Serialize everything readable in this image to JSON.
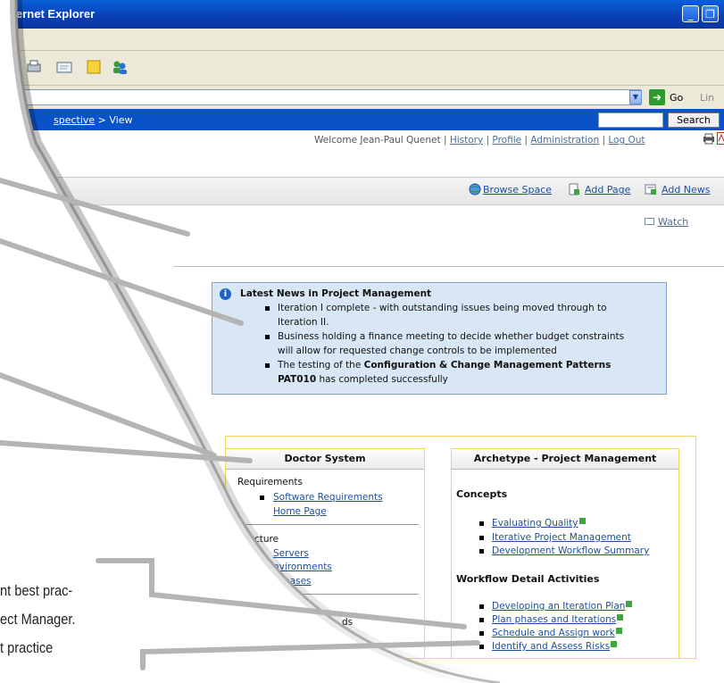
{
  "window": {
    "title": "ernet Explorer",
    "minimize": "_",
    "restore": "❐"
  },
  "address_bar": {
    "go_label": "Go",
    "links_label": "Lin"
  },
  "breadcrumb": {
    "link": "spective",
    "separator": " > ",
    "current": "View"
  },
  "search": {
    "button_label": "Search",
    "value": ""
  },
  "user_bar": {
    "welcome": "Welcome Jean-Paul Quenet | ",
    "history": "History",
    "profile": "Profile",
    "administration": "Administration",
    "logout": "Log Out",
    "sep": " | "
  },
  "actions": {
    "browse_space": "Browse Space",
    "add_page": "Add Page",
    "add_news": "Add News",
    "watch": "Watch"
  },
  "news": {
    "title": "Latest News in Project Management",
    "items": [
      {
        "line1": "Iteration I complete - with outstanding issues being moved through to",
        "line2": "Iteration II."
      },
      {
        "line1": "Business holding a finance meeting to decide whether budget constraints",
        "line2": "will allow for requested change controls to be implemented"
      },
      {
        "prefix": "The testing of the ",
        "bold1": "Configuration & Change Management Patterns",
        "bold2": "PAT010",
        "suffix": " has completed successfully"
      }
    ]
  },
  "doctor_system": {
    "title": "Doctor System",
    "requirements_label": "Requirements",
    "requirements_link_1": "Software Requirements",
    "requirements_link_2": "Home Page",
    "infrastructure_label": "astructure",
    "infra_links": [
      "Servers",
      "nvironments",
      "bases"
    ],
    "partial_text": "ds"
  },
  "archetype": {
    "title": "Archetype - Project Management",
    "concepts_label": "Concepts",
    "concepts": [
      "Evaluating Quality",
      "Iterative Project Management",
      "Development Workflow Summary"
    ],
    "workflow_label": "Workflow Detail Activities",
    "workflow": [
      "Developing an Iteration Plan",
      "Plan phases and Iterations",
      "Schedule and Assign work",
      "Identify and Assess Risks"
    ]
  },
  "callout_text": [
    "nt best prac-",
    "ect Manager.",
    "t practice"
  ],
  "colors": {
    "titlebar": "#0a3fb4",
    "navbar": "#0a52c8",
    "news_bg": "#d9e6f5",
    "box_border": "#f3d460",
    "link": "#1d4f9e"
  }
}
